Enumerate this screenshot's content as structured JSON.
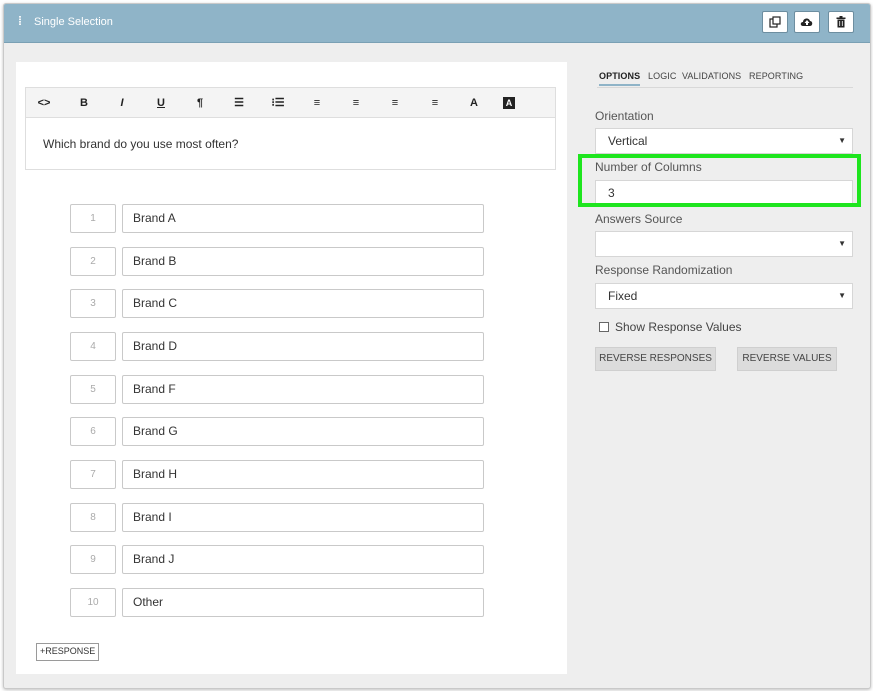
{
  "window": {
    "title": "Single Selection",
    "grip": "⁞"
  },
  "header_actions": [
    {
      "icon": "copy-icon"
    },
    {
      "icon": "cloud-upload-icon"
    },
    {
      "icon": "trash-icon"
    }
  ],
  "toolbar": [
    {
      "name": "code-view-button",
      "glyph": "<>"
    },
    {
      "name": "bold-button",
      "glyph": "B"
    },
    {
      "name": "italic-button",
      "glyph": "I"
    },
    {
      "name": "underline-button",
      "glyph": "U"
    },
    {
      "name": "paragraph-button",
      "glyph": "¶"
    },
    {
      "name": "unordered-list-button",
      "glyph": "☰"
    },
    {
      "name": "ordered-list-button",
      "glyph": "⁝☰"
    },
    {
      "name": "align-left-button",
      "glyph": "≡"
    },
    {
      "name": "align-center-button",
      "glyph": "≡"
    },
    {
      "name": "align-right-button",
      "glyph": "≡"
    },
    {
      "name": "justify-button",
      "glyph": "≡"
    },
    {
      "name": "font-color-button",
      "glyph": "A"
    },
    {
      "name": "background-color-button",
      "glyph": "A"
    }
  ],
  "question": {
    "text": "Which brand do you use most often?"
  },
  "responses": [
    {
      "num": "1",
      "label": "Brand A"
    },
    {
      "num": "2",
      "label": "Brand B"
    },
    {
      "num": "3",
      "label": "Brand C"
    },
    {
      "num": "4",
      "label": "Brand D"
    },
    {
      "num": "5",
      "label": "Brand F"
    },
    {
      "num": "6",
      "label": "Brand G"
    },
    {
      "num": "7",
      "label": "Brand H"
    },
    {
      "num": "8",
      "label": "Brand I"
    },
    {
      "num": "9",
      "label": "Brand J"
    },
    {
      "num": "10",
      "label": "Other"
    }
  ],
  "add_response_label": "+RESPONSE",
  "tabs": [
    {
      "label": "OPTIONS",
      "active": true
    },
    {
      "label": "LOGIC",
      "active": false
    },
    {
      "label": "VALIDATIONS",
      "active": false
    },
    {
      "label": "REPORTING",
      "active": false
    }
  ],
  "options": {
    "orientation_label": "Orientation",
    "orientation_value": "Vertical",
    "columns_label": "Number of Columns",
    "columns_value": "3",
    "source_label": "Answers Source",
    "source_value": "",
    "randomization_label": "Response Randomization",
    "randomization_value": "Fixed",
    "show_values_label": "Show Response Values",
    "reverse_responses_label": "REVERSE RESPONSES",
    "reverse_values_label": "REVERSE VALUES"
  },
  "colors": {
    "titlebar": "#8fb4c8",
    "highlight": "#1ee51e",
    "gray_button": "#dcdcdc"
  }
}
